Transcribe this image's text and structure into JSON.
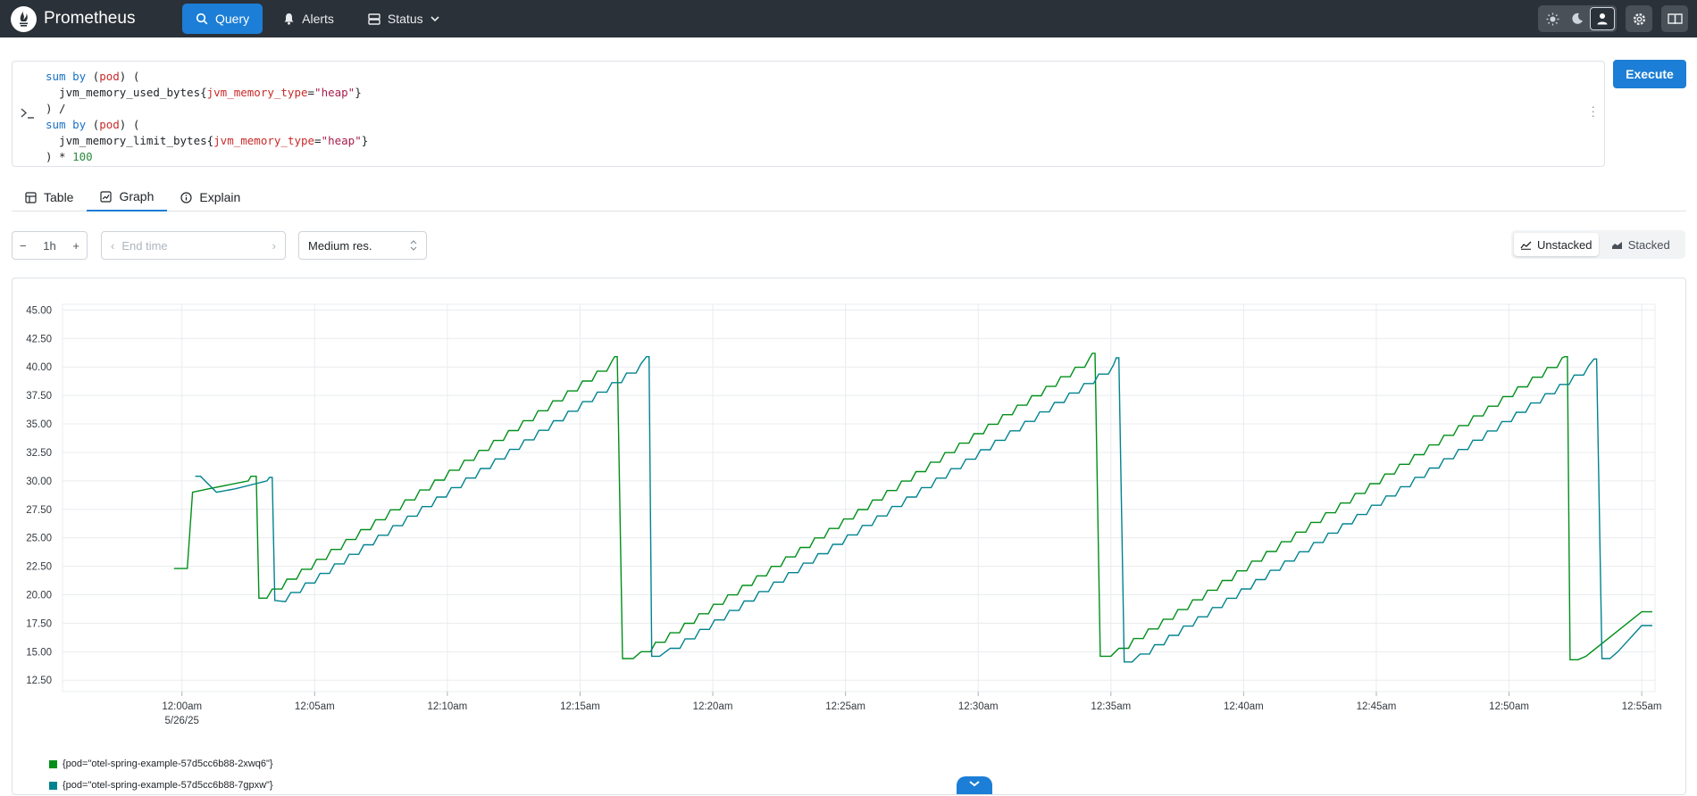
{
  "app": {
    "title": "Prometheus"
  },
  "nav": {
    "query": "Query",
    "alerts": "Alerts",
    "status": "Status"
  },
  "editor": {
    "lines": [
      "sum by (pod) (",
      "  jvm_memory_used_bytes{jvm_memory_type=\"heap\"}",
      ") /",
      "sum by (pod) (",
      "  jvm_memory_limit_bytes{jvm_memory_type=\"heap\"}",
      ") * 100"
    ],
    "execute": "Execute"
  },
  "tabs": {
    "table": "Table",
    "graph": "Graph",
    "explain": "Explain",
    "active": "Graph"
  },
  "controls": {
    "range": "1h",
    "end_time_placeholder": "End time",
    "resolution": "Medium res.",
    "unstacked": "Unstacked",
    "stacked": "Stacked",
    "mode": "Unstacked"
  },
  "colors": {
    "series1": "#008f1a",
    "series2": "#00838f",
    "accent": "#1c7ed6",
    "nav_bg": "#2b3138"
  },
  "chart_data": {
    "type": "line",
    "ylim": [
      11.5,
      45.5
    ],
    "yticks": [
      "45.00",
      "42.50",
      "40.00",
      "37.50",
      "35.00",
      "32.50",
      "30.00",
      "27.50",
      "25.00",
      "22.50",
      "20.00",
      "17.50",
      "15.00",
      "12.50"
    ],
    "xticks": [
      "12:00am",
      "12:05am",
      "12:10am",
      "12:15am",
      "12:20am",
      "12:25am",
      "12:30am",
      "12:35am",
      "12:40am",
      "12:45am",
      "12:50am",
      "12:55am"
    ],
    "x_first_sublabel": "5/26/25",
    "x_unit": "minutes after 12:00am",
    "xlim": [
      -4.5,
      55.5
    ],
    "series": [
      {
        "name": "{pod=\"otel-spring-example-57d5cc6b88-2xwq6\"}",
        "color": "#008f1a",
        "points": [
          [
            -0.3,
            22.3
          ],
          [
            0.2,
            22.3
          ],
          [
            0.4,
            29.0
          ],
          [
            1.0,
            29.3
          ],
          [
            2.5,
            30.0
          ],
          [
            2.6,
            30.4
          ],
          [
            2.8,
            30.4
          ],
          [
            2.9,
            19.7
          ],
          [
            3.2,
            19.7
          ],
          [
            3.4,
            20.5
          ],
          [
            16.2,
            40.5
          ],
          [
            16.3,
            40.9
          ],
          [
            16.4,
            40.9
          ],
          [
            16.6,
            14.4
          ],
          [
            17.0,
            14.4
          ],
          [
            17.3,
            15.0
          ],
          [
            34.2,
            40.8
          ],
          [
            34.3,
            41.2
          ],
          [
            34.4,
            41.2
          ],
          [
            34.6,
            14.6
          ],
          [
            35.0,
            14.6
          ],
          [
            35.3,
            15.3
          ],
          [
            52.0,
            40.8
          ],
          [
            52.1,
            40.9
          ],
          [
            52.2,
            40.9
          ],
          [
            52.3,
            14.3
          ],
          [
            52.6,
            14.3
          ],
          [
            52.9,
            14.6
          ],
          [
            55.0,
            18.5
          ],
          [
            55.4,
            18.5
          ]
        ]
      },
      {
        "name": "{pod=\"otel-spring-example-57d5cc6b88-7gpxw\"}",
        "color": "#00838f",
        "points": [
          [
            0.5,
            30.4
          ],
          [
            0.7,
            30.4
          ],
          [
            1.3,
            29.0
          ],
          [
            2.0,
            29.3
          ],
          [
            3.2,
            30.0
          ],
          [
            3.3,
            30.3
          ],
          [
            3.4,
            30.3
          ],
          [
            3.5,
            19.5
          ],
          [
            3.9,
            19.4
          ],
          [
            4.1,
            20.2
          ],
          [
            17.3,
            40.3
          ],
          [
            17.5,
            40.9
          ],
          [
            17.6,
            40.9
          ],
          [
            17.7,
            14.6
          ],
          [
            18.0,
            14.6
          ],
          [
            18.4,
            15.3
          ],
          [
            35.1,
            40.2
          ],
          [
            35.2,
            40.8
          ],
          [
            35.3,
            40.8
          ],
          [
            35.5,
            14.1
          ],
          [
            35.8,
            14.1
          ],
          [
            36.1,
            14.8
          ],
          [
            53.0,
            40.1
          ],
          [
            53.2,
            40.7
          ],
          [
            53.3,
            40.7
          ],
          [
            53.5,
            14.4
          ],
          [
            53.8,
            14.4
          ],
          [
            54.1,
            15.0
          ],
          [
            55.0,
            17.3
          ],
          [
            55.4,
            17.3
          ]
        ]
      }
    ]
  }
}
